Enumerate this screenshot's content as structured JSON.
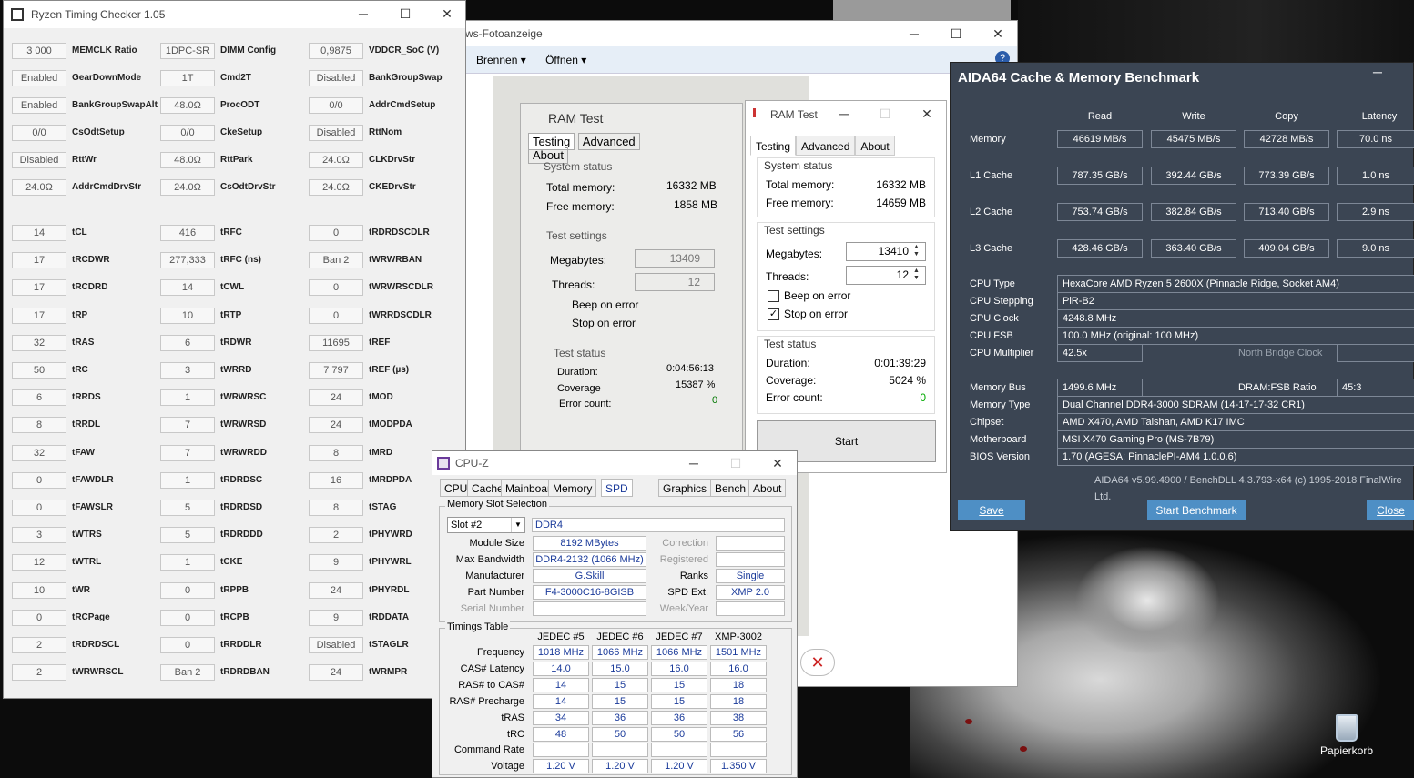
{
  "desktop": {
    "recycle_bin_label": "Papierkorb"
  },
  "photos": {
    "title": "ws-Fotoanzeige",
    "menu": [
      "Brennen ▾",
      "Öffnen ▾"
    ]
  },
  "rtc": {
    "title": "Ryzen Timing Checker 1.05",
    "rows": [
      [
        "3 000",
        "MEMCLK Ratio",
        "1DPC-SR",
        "DIMM Config",
        "0,9875",
        "VDDCR_SoC (V)"
      ],
      [
        "Enabled",
        "GearDownMode",
        "1T",
        "Cmd2T",
        "Disabled",
        "BankGroupSwap"
      ],
      [
        "Enabled",
        "BankGroupSwapAlt",
        "48.0Ω",
        "ProcODT",
        "0/0",
        "AddrCmdSetup"
      ],
      [
        "0/0",
        "CsOdtSetup",
        "0/0",
        "CkeSetup",
        "Disabled",
        "RttNom"
      ],
      [
        "Disabled",
        "RttWr",
        "48.0Ω",
        "RttPark",
        "24.0Ω",
        "CLKDrvStr"
      ],
      [
        "24.0Ω",
        "AddrCmdDrvStr",
        "24.0Ω",
        "CsOdtDrvStr",
        "24.0Ω",
        "CKEDrvStr"
      ],
      [
        "14",
        "tCL",
        "416",
        "tRFC",
        "0",
        "tRDRDSCDLR"
      ],
      [
        "17",
        "tRCDWR",
        "277,333",
        "tRFC (ns)",
        "Ban 2",
        "tWRWRBAN"
      ],
      [
        "17",
        "tRCDRD",
        "14",
        "tCWL",
        "0",
        "tWRWRSCDLR"
      ],
      [
        "17",
        "tRP",
        "10",
        "tRTP",
        "0",
        "tWRRDSCDLR"
      ],
      [
        "32",
        "tRAS",
        "6",
        "tRDWR",
        "11695",
        "tREF"
      ],
      [
        "50",
        "tRC",
        "3",
        "tWRRD",
        "7 797",
        "tREF (µs)"
      ],
      [
        "6",
        "tRRDS",
        "1",
        "tWRWRSC",
        "24",
        "tMOD"
      ],
      [
        "8",
        "tRRDL",
        "7",
        "tWRWRSD",
        "24",
        "tMODPDA"
      ],
      [
        "32",
        "tFAW",
        "7",
        "tWRWRDD",
        "8",
        "tMRD"
      ],
      [
        "0",
        "tFAWDLR",
        "1",
        "tRDRDSC",
        "16",
        "tMRDPDA"
      ],
      [
        "0",
        "tFAWSLR",
        "5",
        "tRDRDSD",
        "8",
        "tSTAG"
      ],
      [
        "3",
        "tWTRS",
        "5",
        "tRDRDDD",
        "2",
        "tPHYWRD"
      ],
      [
        "12",
        "tWTRL",
        "1",
        "tCKE",
        "9",
        "tPHYWRL"
      ],
      [
        "10",
        "tWR",
        "0",
        "tRPPB",
        "24",
        "tPHYRDL"
      ],
      [
        "0",
        "tRCPage",
        "0",
        "tRCPB",
        "9",
        "tRDDATA"
      ],
      [
        "2",
        "tRDRDSCL",
        "0",
        "tRRDDLR",
        "Disabled",
        "tSTAGLR"
      ],
      [
        "2",
        "tWRWRSCL",
        "Ban 2",
        "tRDRDBAN",
        "24",
        "tWRMPR"
      ]
    ]
  },
  "ramtest_photo": {
    "title": "RAM Test",
    "tabs": [
      "Testing",
      "Advanced",
      "About"
    ],
    "system_status": "System status",
    "total_memory_label": "Total memory:",
    "total_memory": "16332 MB",
    "free_memory_label": "Free memory:",
    "free_memory": "1858 MB",
    "test_settings": "Test settings",
    "megabytes_label": "Megabytes:",
    "megabytes": "13409",
    "threads_label": "Threads:",
    "threads": "12",
    "beep": "Beep on error",
    "stop": "Stop on error",
    "test_status": "Test status",
    "duration_label": "Duration:",
    "duration": "0:04:56:13",
    "coverage_label": "Coverage",
    "coverage": "15387 %",
    "error_label": "Error count:",
    "error": "0"
  },
  "ramtest": {
    "title": "RAM Test",
    "tabs": [
      "Testing",
      "Advanced",
      "About"
    ],
    "system_status": "System status",
    "total_memory_label": "Total memory:",
    "total_memory": "16332 MB",
    "free_memory_label": "Free memory:",
    "free_memory": "14659 MB",
    "test_settings": "Test settings",
    "megabytes_label": "Megabytes:",
    "megabytes": "13410",
    "threads_label": "Threads:",
    "threads": "12",
    "beep": "Beep on error",
    "stop": "Stop on error",
    "test_status": "Test status",
    "duration_label": "Duration:",
    "duration": "0:01:39:29",
    "coverage_label": "Coverage:",
    "coverage": "5024 %",
    "error_label": "Error count:",
    "error": "0",
    "start": "Start"
  },
  "cpuz": {
    "title": "CPU-Z",
    "tabs": [
      "CPU",
      "Caches",
      "Mainboard",
      "Memory",
      "SPD",
      "Graphics",
      "Bench",
      "About"
    ],
    "slot_group": "Memory Slot Selection",
    "slot": "Slot #2",
    "type": "DDR4",
    "module_size_label": "Module Size",
    "module_size": "8192 MBytes",
    "max_bw_label": "Max Bandwidth",
    "max_bw": "DDR4-2132 (1066 MHz)",
    "manufacturer_label": "Manufacturer",
    "manufacturer": "G.Skill",
    "part_label": "Part Number",
    "part": "F4-3000C16-8GISB",
    "serial_label": "Serial Number",
    "correction_label": "Correction",
    "registered_label": "Registered",
    "ranks_label": "Ranks",
    "ranks": "Single",
    "spd_ext_label": "SPD Ext.",
    "spd_ext": "XMP 2.0",
    "week_label": "Week/Year",
    "timings_group": "Timings Table",
    "cols": [
      "JEDEC #5",
      "JEDEC #6",
      "JEDEC #7",
      "XMP-3002"
    ],
    "rows": [
      {
        "label": "Frequency",
        "vals": [
          "1018 MHz",
          "1066 MHz",
          "1066 MHz",
          "1501 MHz"
        ]
      },
      {
        "label": "CAS# Latency",
        "vals": [
          "14.0",
          "15.0",
          "16.0",
          "16.0"
        ]
      },
      {
        "label": "RAS# to CAS#",
        "vals": [
          "14",
          "15",
          "15",
          "18"
        ]
      },
      {
        "label": "RAS# Precharge",
        "vals": [
          "14",
          "15",
          "15",
          "18"
        ]
      },
      {
        "label": "tRAS",
        "vals": [
          "34",
          "36",
          "36",
          "38"
        ]
      },
      {
        "label": "tRC",
        "vals": [
          "48",
          "50",
          "50",
          "56"
        ]
      },
      {
        "label": "Command Rate",
        "vals": [
          "",
          "",
          "",
          ""
        ]
      },
      {
        "label": "Voltage",
        "vals": [
          "1.20 V",
          "1.20 V",
          "1.20 V",
          "1.350 V"
        ]
      }
    ]
  },
  "aida": {
    "title": "AIDA64 Cache & Memory Benchmark",
    "cols": [
      "Read",
      "Write",
      "Copy",
      "Latency"
    ],
    "rows": [
      {
        "label": "Memory",
        "vals": [
          "46619 MB/s",
          "45475 MB/s",
          "42728 MB/s",
          "70.0 ns"
        ]
      },
      {
        "label": "L1 Cache",
        "vals": [
          "787.35 GB/s",
          "392.44 GB/s",
          "773.39 GB/s",
          "1.0 ns"
        ]
      },
      {
        "label": "L2 Cache",
        "vals": [
          "753.74 GB/s",
          "382.84 GB/s",
          "713.40 GB/s",
          "2.9 ns"
        ]
      },
      {
        "label": "L3 Cache",
        "vals": [
          "428.46 GB/s",
          "363.40 GB/s",
          "409.04 GB/s",
          "9.0 ns"
        ]
      }
    ],
    "cpu_type_label": "CPU Type",
    "cpu_type": "HexaCore AMD Ryzen 5 2600X  (Pinnacle Ridge, Socket AM4)",
    "cpu_stepping_label": "CPU Stepping",
    "cpu_stepping": "PiR-B2",
    "cpu_clock_label": "CPU Clock",
    "cpu_clock": "4248.8 MHz",
    "cpu_fsb_label": "CPU FSB",
    "cpu_fsb": "100.0 MHz  (original: 100 MHz)",
    "cpu_mult_label": "CPU Multiplier",
    "cpu_mult": "42.5x",
    "nb_clock_label": "North Bridge Clock",
    "mem_bus_label": "Memory Bus",
    "mem_bus": "1499.6 MHz",
    "dram_fsb_label": "DRAM:FSB Ratio",
    "dram_fsb": "45:3",
    "mem_type_label": "Memory Type",
    "mem_type": "Dual Channel DDR4-3000 SDRAM  (14-17-17-32 CR1)",
    "chipset_label": "Chipset",
    "chipset": "AMD X470, AMD Taishan, AMD K17 IMC",
    "mobo_label": "Motherboard",
    "mobo": "MSI X470 Gaming Pro (MS-7B79)",
    "bios_label": "BIOS Version",
    "bios": "1.70  (AGESA: PinnaclePI-AM4 1.0.0.6)",
    "footer": "AIDA64 v5.99.4900 / BenchDLL 4.3.793-x64  (c) 1995-2018 FinalWire Ltd.",
    "save": "Save",
    "start": "Start Benchmark",
    "close": "Close"
  }
}
